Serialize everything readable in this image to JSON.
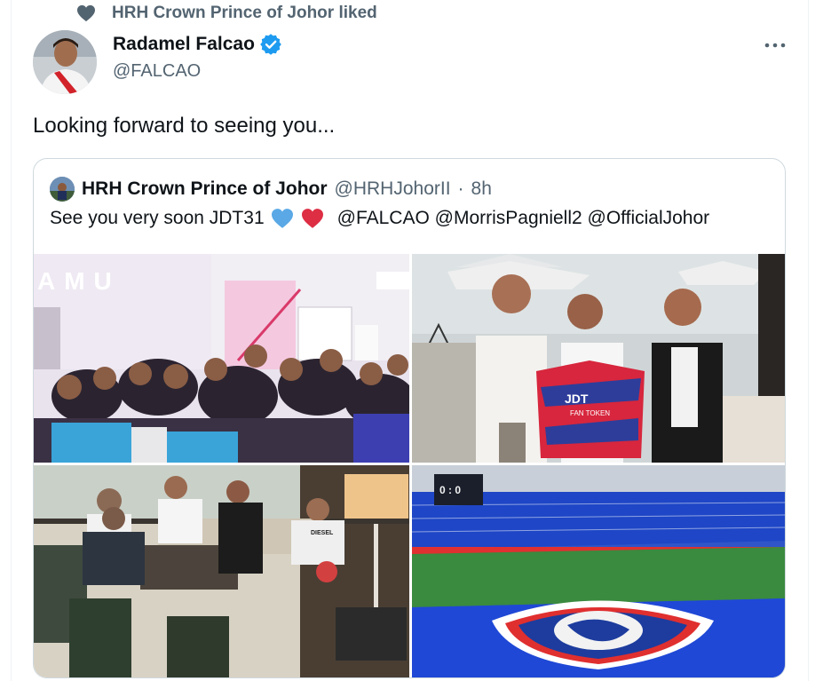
{
  "social_context": {
    "text": "HRH Crown Prince of Johor liked",
    "icon": "heart-icon"
  },
  "author": {
    "display_name": "Radamel Falcao",
    "handle": "@FALCAO",
    "verified": true
  },
  "tweet": {
    "text": "Looking forward to seeing you..."
  },
  "quoted": {
    "display_name": "HRH Crown Prince of Johor",
    "handle": "@HRHJohorII",
    "separator": "·",
    "time": "8h",
    "text": "See you very soon JDT31",
    "emojis": [
      "blue-heart-icon",
      "red-heart-icon"
    ],
    "mentions": "@FALCAO @MorrisPagniell2 @OfficialJohor"
  },
  "photos": {
    "p1_sign": "AMU",
    "p2_jersey": "JDT",
    "p2_jersey_sub": "FAN TOKEN",
    "p3_shirt": "DIESEL",
    "p4_scoreboard": "0 : 0"
  },
  "colors": {
    "accent": "#1d9bf0",
    "text": "#0f1419",
    "muted": "#536471",
    "border": "#cfd9de",
    "heart_blue": "#5aa9e6",
    "heart_red": "#dd2e44"
  }
}
